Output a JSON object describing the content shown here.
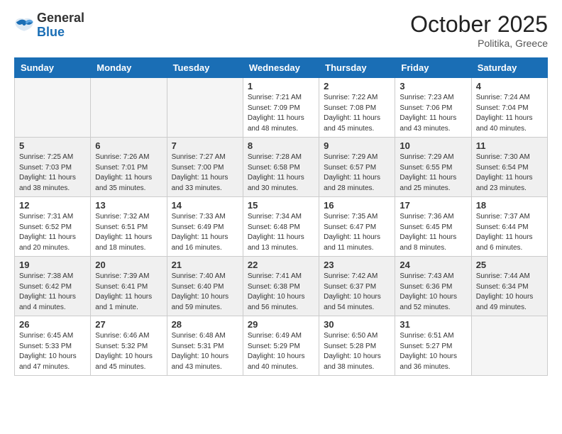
{
  "header": {
    "logo_general": "General",
    "logo_blue": "Blue",
    "month_title": "October 2025",
    "subtitle": "Politika, Greece"
  },
  "weekdays": [
    "Sunday",
    "Monday",
    "Tuesday",
    "Wednesday",
    "Thursday",
    "Friday",
    "Saturday"
  ],
  "weeks": [
    [
      {
        "day": "",
        "info": ""
      },
      {
        "day": "",
        "info": ""
      },
      {
        "day": "",
        "info": ""
      },
      {
        "day": "1",
        "info": "Sunrise: 7:21 AM\nSunset: 7:09 PM\nDaylight: 11 hours\nand 48 minutes."
      },
      {
        "day": "2",
        "info": "Sunrise: 7:22 AM\nSunset: 7:08 PM\nDaylight: 11 hours\nand 45 minutes."
      },
      {
        "day": "3",
        "info": "Sunrise: 7:23 AM\nSunset: 7:06 PM\nDaylight: 11 hours\nand 43 minutes."
      },
      {
        "day": "4",
        "info": "Sunrise: 7:24 AM\nSunset: 7:04 PM\nDaylight: 11 hours\nand 40 minutes."
      }
    ],
    [
      {
        "day": "5",
        "info": "Sunrise: 7:25 AM\nSunset: 7:03 PM\nDaylight: 11 hours\nand 38 minutes."
      },
      {
        "day": "6",
        "info": "Sunrise: 7:26 AM\nSunset: 7:01 PM\nDaylight: 11 hours\nand 35 minutes."
      },
      {
        "day": "7",
        "info": "Sunrise: 7:27 AM\nSunset: 7:00 PM\nDaylight: 11 hours\nand 33 minutes."
      },
      {
        "day": "8",
        "info": "Sunrise: 7:28 AM\nSunset: 6:58 PM\nDaylight: 11 hours\nand 30 minutes."
      },
      {
        "day": "9",
        "info": "Sunrise: 7:29 AM\nSunset: 6:57 PM\nDaylight: 11 hours\nand 28 minutes."
      },
      {
        "day": "10",
        "info": "Sunrise: 7:29 AM\nSunset: 6:55 PM\nDaylight: 11 hours\nand 25 minutes."
      },
      {
        "day": "11",
        "info": "Sunrise: 7:30 AM\nSunset: 6:54 PM\nDaylight: 11 hours\nand 23 minutes."
      }
    ],
    [
      {
        "day": "12",
        "info": "Sunrise: 7:31 AM\nSunset: 6:52 PM\nDaylight: 11 hours\nand 20 minutes."
      },
      {
        "day": "13",
        "info": "Sunrise: 7:32 AM\nSunset: 6:51 PM\nDaylight: 11 hours\nand 18 minutes."
      },
      {
        "day": "14",
        "info": "Sunrise: 7:33 AM\nSunset: 6:49 PM\nDaylight: 11 hours\nand 16 minutes."
      },
      {
        "day": "15",
        "info": "Sunrise: 7:34 AM\nSunset: 6:48 PM\nDaylight: 11 hours\nand 13 minutes."
      },
      {
        "day": "16",
        "info": "Sunrise: 7:35 AM\nSunset: 6:47 PM\nDaylight: 11 hours\nand 11 minutes."
      },
      {
        "day": "17",
        "info": "Sunrise: 7:36 AM\nSunset: 6:45 PM\nDaylight: 11 hours\nand 8 minutes."
      },
      {
        "day": "18",
        "info": "Sunrise: 7:37 AM\nSunset: 6:44 PM\nDaylight: 11 hours\nand 6 minutes."
      }
    ],
    [
      {
        "day": "19",
        "info": "Sunrise: 7:38 AM\nSunset: 6:42 PM\nDaylight: 11 hours\nand 4 minutes."
      },
      {
        "day": "20",
        "info": "Sunrise: 7:39 AM\nSunset: 6:41 PM\nDaylight: 11 hours\nand 1 minute."
      },
      {
        "day": "21",
        "info": "Sunrise: 7:40 AM\nSunset: 6:40 PM\nDaylight: 10 hours\nand 59 minutes."
      },
      {
        "day": "22",
        "info": "Sunrise: 7:41 AM\nSunset: 6:38 PM\nDaylight: 10 hours\nand 56 minutes."
      },
      {
        "day": "23",
        "info": "Sunrise: 7:42 AM\nSunset: 6:37 PM\nDaylight: 10 hours\nand 54 minutes."
      },
      {
        "day": "24",
        "info": "Sunrise: 7:43 AM\nSunset: 6:36 PM\nDaylight: 10 hours\nand 52 minutes."
      },
      {
        "day": "25",
        "info": "Sunrise: 7:44 AM\nSunset: 6:34 PM\nDaylight: 10 hours\nand 49 minutes."
      }
    ],
    [
      {
        "day": "26",
        "info": "Sunrise: 6:45 AM\nSunset: 5:33 PM\nDaylight: 10 hours\nand 47 minutes."
      },
      {
        "day": "27",
        "info": "Sunrise: 6:46 AM\nSunset: 5:32 PM\nDaylight: 10 hours\nand 45 minutes."
      },
      {
        "day": "28",
        "info": "Sunrise: 6:48 AM\nSunset: 5:31 PM\nDaylight: 10 hours\nand 43 minutes."
      },
      {
        "day": "29",
        "info": "Sunrise: 6:49 AM\nSunset: 5:29 PM\nDaylight: 10 hours\nand 40 minutes."
      },
      {
        "day": "30",
        "info": "Sunrise: 6:50 AM\nSunset: 5:28 PM\nDaylight: 10 hours\nand 38 minutes."
      },
      {
        "day": "31",
        "info": "Sunrise: 6:51 AM\nSunset: 5:27 PM\nDaylight: 10 hours\nand 36 minutes."
      },
      {
        "day": "",
        "info": ""
      }
    ]
  ]
}
